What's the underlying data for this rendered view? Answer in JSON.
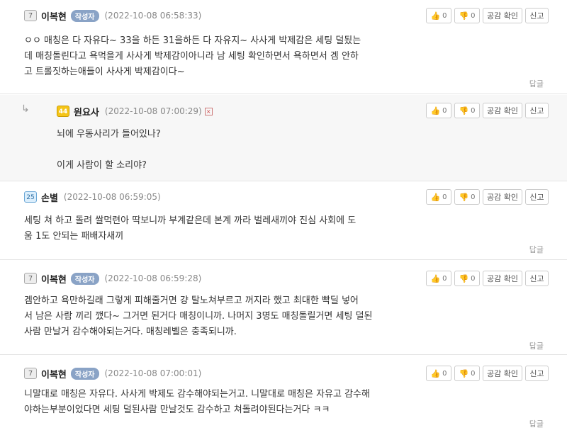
{
  "buttons": {
    "like_count": "0",
    "dislike_count": "0",
    "empathy_label": "공감 확인",
    "report_label": "신고",
    "answer_label": "답글"
  },
  "comments": [
    {
      "level": "7",
      "nick": "이복현",
      "badge": "작성자",
      "date": "(2022-10-08 06:58:33)",
      "text": "ㅇㅇ 매칭은 다 자유다~ 33을 하든 31을하든 다 자유지~ 사사게 박제감은 세팅 덜됬는\n데 매칭돌린다고 욕먹을게 사사게 박제감이아니라 남 세팅 확인하면서 욕하면서 겜 안하\n고 트롤짓하는애들이 사사게 박제감이다~"
    },
    {
      "level": "44",
      "nick": "원요사",
      "date": "(2022-10-08 07:00:29)",
      "mark": "×",
      "text": "뇌에 우동사리가 들어있나?\n\n이게 사람이 할 소리야?"
    },
    {
      "level": "25",
      "nick": "손별",
      "date": "(2022-10-08 06:59:05)",
      "text": "세팅 쳐 하고 돌려 쌀먹련아 딱보니까 부계같은데 본계 까라 벌레새끼야 진심 사회에 도\n움 1도 안되는 패배자새끼"
    },
    {
      "level": "7",
      "nick": "이복현",
      "badge": "작성자",
      "date": "(2022-10-08 06:59:28)",
      "text": "겜안하고 욕만하길래 그렇게 피해줄거면 걍 탈노쳐부르고 꺼지라 했고 최대한 빡딜 넣어\n서 남은 사람 끼리 깼다~ 그거면 된거다 매칭이니까. 나머지 3명도 매칭돌릴거면 세팅 덜된\n사람 만날거 감수해야되는거다. 매칭레벨은 충족되니까."
    },
    {
      "level": "7",
      "nick": "이복현",
      "badge": "작성자",
      "date": "(2022-10-08 07:00:01)",
      "text": "니말대로 매칭은 자유다. 사사게 박제도 감수해야되는거고. 니말대로 매칭은 자유고 감수해\n야하는부분이었다면 세팅 덜된사람 만날것도 감수하고 쳐돌려야된다는거다 ㅋㅋ"
    }
  ]
}
